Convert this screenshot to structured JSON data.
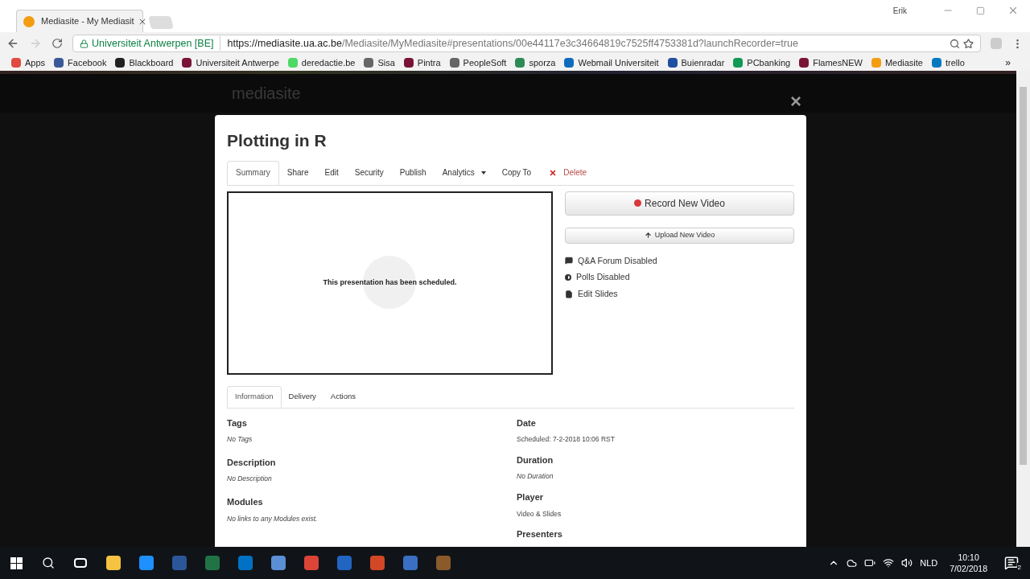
{
  "browser": {
    "tabs": [
      {
        "title": "Mediasite - My Mediasit",
        "selected": true
      }
    ],
    "profile": "Erik",
    "security_label": "Universiteit Antwerpen [BE]",
    "url": {
      "origin": "https://mediasite.ua.ac.be",
      "path": "/Mediasite/MyMediasite#presentations/00e44117e3c34664819c7525ff4753381d?launchRecorder=true"
    },
    "bookmarks": [
      {
        "label": "Apps",
        "color": "#e04a3f"
      },
      {
        "label": "Facebook",
        "color": "#3b5998"
      },
      {
        "label": "Blackboard",
        "color": "#222222"
      },
      {
        "label": "Universiteit Antwerpe",
        "color": "#7a1437"
      },
      {
        "label": "deredactie.be",
        "color": "#4cd964"
      },
      {
        "label": "Sisa",
        "color": "#666666"
      },
      {
        "label": "Pintra",
        "color": "#7a1437"
      },
      {
        "label": "PeopleSoft",
        "color": "#666666"
      },
      {
        "label": "sporza",
        "color": "#2e8b57"
      },
      {
        "label": "Webmail Universiteit",
        "color": "#0f6cbd"
      },
      {
        "label": "Buienradar",
        "color": "#1e4fa0"
      },
      {
        "label": "PCbanking",
        "color": "#119955"
      },
      {
        "label": "FlamesNEW",
        "color": "#7a1437"
      },
      {
        "label": "Mediasite",
        "color": "#f39c12"
      },
      {
        "label": "trello",
        "color": "#0079bf"
      }
    ],
    "overflow": "»"
  },
  "site": {
    "logo": "mediasite"
  },
  "modal": {
    "close": "×",
    "title": "Plotting in R",
    "tabs": [
      {
        "label": "Summary",
        "selected": true,
        "kind": "tab"
      },
      {
        "label": "Share",
        "selected": false,
        "kind": "tab"
      },
      {
        "label": "Edit",
        "selected": false,
        "kind": "tab"
      },
      {
        "label": "Security",
        "selected": false,
        "kind": "tab"
      },
      {
        "label": "Publish",
        "selected": false,
        "kind": "tab"
      },
      {
        "label": "Analytics",
        "selected": false,
        "kind": "dropdown"
      },
      {
        "label": "Copy To",
        "selected": false,
        "kind": "tab"
      },
      {
        "label": "Delete",
        "selected": false,
        "kind": "delete"
      }
    ],
    "preview_message": "This presentation has been scheduled.",
    "record_button": "Record New Video",
    "upload_button": "Upload New Video",
    "features": [
      {
        "label": "Q&A Forum Disabled",
        "kind": "forum"
      },
      {
        "label": "Polls Disabled",
        "kind": "polls"
      },
      {
        "label": "Edit Slides",
        "kind": "slides"
      }
    ],
    "info_tabs": [
      {
        "label": "Information",
        "selected": true
      },
      {
        "label": "Delivery",
        "selected": false
      },
      {
        "label": "Actions",
        "selected": false
      }
    ],
    "left_fields": [
      {
        "heading": "Tags",
        "value": "No Tags"
      },
      {
        "heading": "Description",
        "value": "No Description"
      },
      {
        "heading": "Modules",
        "value": "No links to any Modules exist."
      }
    ],
    "right_fields": [
      {
        "heading": "Date",
        "value": "Scheduled: 7-2-2018 10:06 RST"
      },
      {
        "heading": "Duration",
        "value": "No Duration"
      },
      {
        "heading": "Player",
        "value": "Video & Slides"
      },
      {
        "heading": "Presenters"
      }
    ]
  },
  "taskbar": {
    "apps": [
      {
        "color": "#f5c242"
      },
      {
        "color": "#1e90ff"
      },
      {
        "color": "#2b579a"
      },
      {
        "color": "#217346"
      },
      {
        "color": "#0072c6"
      },
      {
        "color": "#5b8fd6"
      },
      {
        "color": "#db4437"
      },
      {
        "color": "#2165c0"
      },
      {
        "color": "#d24726"
      },
      {
        "color": "#3a6fc4"
      },
      {
        "color": "#8a5a2b"
      }
    ],
    "language": "NLD",
    "time": "10:10",
    "date": "7/02/2018",
    "notifications": "2"
  }
}
